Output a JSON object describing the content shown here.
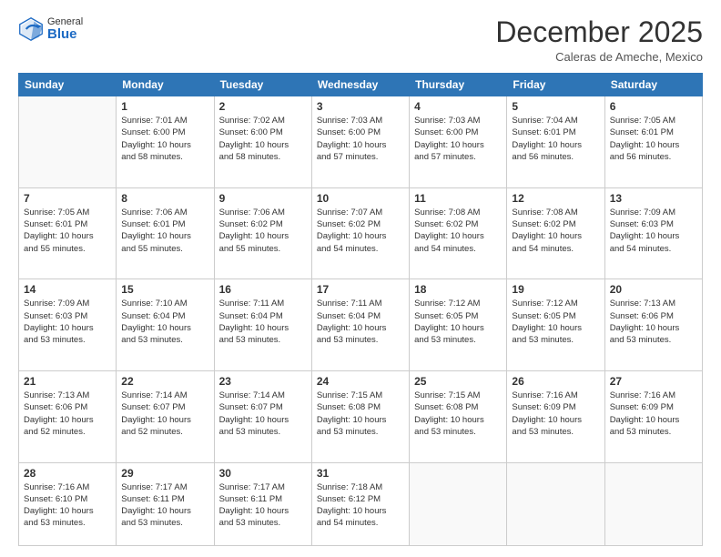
{
  "header": {
    "logo_general": "General",
    "logo_blue": "Blue",
    "month_title": "December 2025",
    "location": "Caleras de Ameche, Mexico"
  },
  "days_of_week": [
    "Sunday",
    "Monday",
    "Tuesday",
    "Wednesday",
    "Thursday",
    "Friday",
    "Saturday"
  ],
  "weeks": [
    [
      {
        "day": "",
        "info": ""
      },
      {
        "day": "1",
        "info": "Sunrise: 7:01 AM\nSunset: 6:00 PM\nDaylight: 10 hours\nand 58 minutes."
      },
      {
        "day": "2",
        "info": "Sunrise: 7:02 AM\nSunset: 6:00 PM\nDaylight: 10 hours\nand 58 minutes."
      },
      {
        "day": "3",
        "info": "Sunrise: 7:03 AM\nSunset: 6:00 PM\nDaylight: 10 hours\nand 57 minutes."
      },
      {
        "day": "4",
        "info": "Sunrise: 7:03 AM\nSunset: 6:00 PM\nDaylight: 10 hours\nand 57 minutes."
      },
      {
        "day": "5",
        "info": "Sunrise: 7:04 AM\nSunset: 6:01 PM\nDaylight: 10 hours\nand 56 minutes."
      },
      {
        "day": "6",
        "info": "Sunrise: 7:05 AM\nSunset: 6:01 PM\nDaylight: 10 hours\nand 56 minutes."
      }
    ],
    [
      {
        "day": "7",
        "info": "Sunrise: 7:05 AM\nSunset: 6:01 PM\nDaylight: 10 hours\nand 55 minutes."
      },
      {
        "day": "8",
        "info": "Sunrise: 7:06 AM\nSunset: 6:01 PM\nDaylight: 10 hours\nand 55 minutes."
      },
      {
        "day": "9",
        "info": "Sunrise: 7:06 AM\nSunset: 6:02 PM\nDaylight: 10 hours\nand 55 minutes."
      },
      {
        "day": "10",
        "info": "Sunrise: 7:07 AM\nSunset: 6:02 PM\nDaylight: 10 hours\nand 54 minutes."
      },
      {
        "day": "11",
        "info": "Sunrise: 7:08 AM\nSunset: 6:02 PM\nDaylight: 10 hours\nand 54 minutes."
      },
      {
        "day": "12",
        "info": "Sunrise: 7:08 AM\nSunset: 6:02 PM\nDaylight: 10 hours\nand 54 minutes."
      },
      {
        "day": "13",
        "info": "Sunrise: 7:09 AM\nSunset: 6:03 PM\nDaylight: 10 hours\nand 54 minutes."
      }
    ],
    [
      {
        "day": "14",
        "info": "Sunrise: 7:09 AM\nSunset: 6:03 PM\nDaylight: 10 hours\nand 53 minutes."
      },
      {
        "day": "15",
        "info": "Sunrise: 7:10 AM\nSunset: 6:04 PM\nDaylight: 10 hours\nand 53 minutes."
      },
      {
        "day": "16",
        "info": "Sunrise: 7:11 AM\nSunset: 6:04 PM\nDaylight: 10 hours\nand 53 minutes."
      },
      {
        "day": "17",
        "info": "Sunrise: 7:11 AM\nSunset: 6:04 PM\nDaylight: 10 hours\nand 53 minutes."
      },
      {
        "day": "18",
        "info": "Sunrise: 7:12 AM\nSunset: 6:05 PM\nDaylight: 10 hours\nand 53 minutes."
      },
      {
        "day": "19",
        "info": "Sunrise: 7:12 AM\nSunset: 6:05 PM\nDaylight: 10 hours\nand 53 minutes."
      },
      {
        "day": "20",
        "info": "Sunrise: 7:13 AM\nSunset: 6:06 PM\nDaylight: 10 hours\nand 53 minutes."
      }
    ],
    [
      {
        "day": "21",
        "info": "Sunrise: 7:13 AM\nSunset: 6:06 PM\nDaylight: 10 hours\nand 52 minutes."
      },
      {
        "day": "22",
        "info": "Sunrise: 7:14 AM\nSunset: 6:07 PM\nDaylight: 10 hours\nand 52 minutes."
      },
      {
        "day": "23",
        "info": "Sunrise: 7:14 AM\nSunset: 6:07 PM\nDaylight: 10 hours\nand 53 minutes."
      },
      {
        "day": "24",
        "info": "Sunrise: 7:15 AM\nSunset: 6:08 PM\nDaylight: 10 hours\nand 53 minutes."
      },
      {
        "day": "25",
        "info": "Sunrise: 7:15 AM\nSunset: 6:08 PM\nDaylight: 10 hours\nand 53 minutes."
      },
      {
        "day": "26",
        "info": "Sunrise: 7:16 AM\nSunset: 6:09 PM\nDaylight: 10 hours\nand 53 minutes."
      },
      {
        "day": "27",
        "info": "Sunrise: 7:16 AM\nSunset: 6:09 PM\nDaylight: 10 hours\nand 53 minutes."
      }
    ],
    [
      {
        "day": "28",
        "info": "Sunrise: 7:16 AM\nSunset: 6:10 PM\nDaylight: 10 hours\nand 53 minutes."
      },
      {
        "day": "29",
        "info": "Sunrise: 7:17 AM\nSunset: 6:11 PM\nDaylight: 10 hours\nand 53 minutes."
      },
      {
        "day": "30",
        "info": "Sunrise: 7:17 AM\nSunset: 6:11 PM\nDaylight: 10 hours\nand 53 minutes."
      },
      {
        "day": "31",
        "info": "Sunrise: 7:18 AM\nSunset: 6:12 PM\nDaylight: 10 hours\nand 54 minutes."
      },
      {
        "day": "",
        "info": ""
      },
      {
        "day": "",
        "info": ""
      },
      {
        "day": "",
        "info": ""
      }
    ]
  ]
}
